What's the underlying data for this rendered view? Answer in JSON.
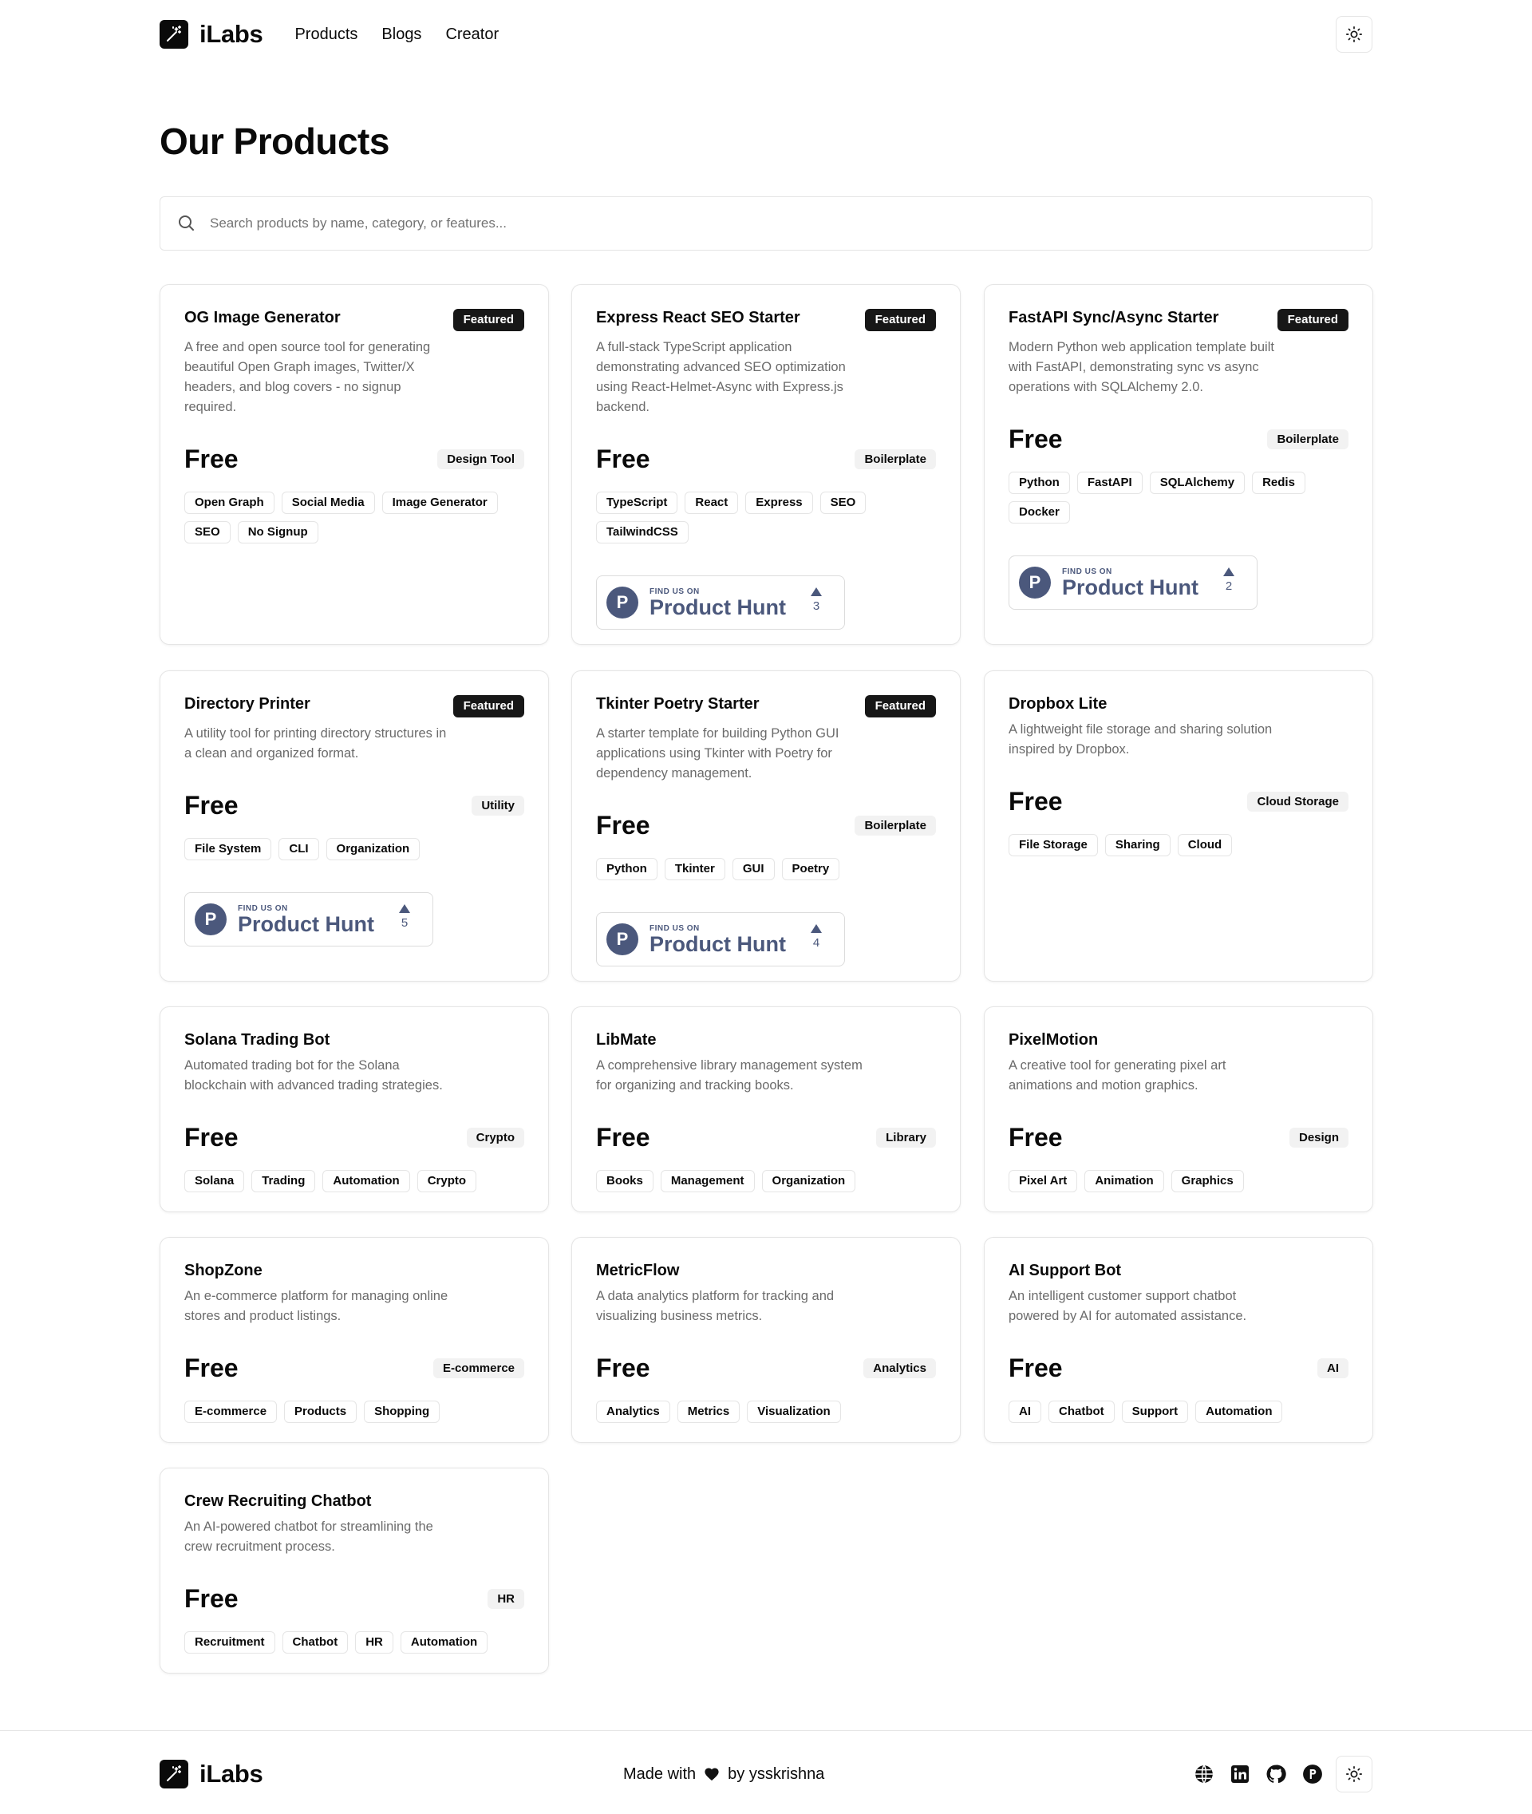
{
  "header": {
    "brand": "iLabs",
    "nav": [
      "Products",
      "Blogs",
      "Creator"
    ]
  },
  "page": {
    "title": "Our Products",
    "search_placeholder": "Search products by name, category, or features..."
  },
  "product_hunt": {
    "small": "FIND US ON",
    "big": "Product Hunt"
  },
  "products": [
    {
      "title": "OG Image Generator",
      "featured": "Featured",
      "desc": "A free and open source tool for generating beautiful Open Graph images, Twitter/X headers, and blog covers - no signup required.",
      "price": "Free",
      "category": "Design Tool",
      "tags": [
        "Open Graph",
        "Social Media",
        "Image Generator",
        "SEO",
        "No Signup"
      ]
    },
    {
      "title": "Express React SEO Starter",
      "featured": "Featured",
      "desc": "A full-stack TypeScript application demonstrating advanced SEO optimization using React-Helmet-Async with Express.js backend.",
      "price": "Free",
      "category": "Boilerplate",
      "tags": [
        "TypeScript",
        "React",
        "Express",
        "SEO",
        "TailwindCSS"
      ],
      "votes": "3"
    },
    {
      "title": "FastAPI Sync/Async Starter",
      "featured": "Featured",
      "desc": "Modern Python web application template built with FastAPI, demonstrating sync vs async operations with SQLAlchemy 2.0.",
      "price": "Free",
      "category": "Boilerplate",
      "tags": [
        "Python",
        "FastAPI",
        "SQLAlchemy",
        "Redis",
        "Docker"
      ],
      "votes": "2"
    },
    {
      "title": "Directory Printer",
      "featured": "Featured",
      "desc": "A utility tool for printing directory structures in a clean and organized format.",
      "price": "Free",
      "category": "Utility",
      "tags": [
        "File System",
        "CLI",
        "Organization"
      ],
      "votes": "5"
    },
    {
      "title": "Tkinter Poetry Starter",
      "featured": "Featured",
      "desc": "A starter template for building Python GUI applications using Tkinter with Poetry for dependency management.",
      "price": "Free",
      "category": "Boilerplate",
      "tags": [
        "Python",
        "Tkinter",
        "GUI",
        "Poetry"
      ],
      "votes": "4"
    },
    {
      "title": "Dropbox Lite",
      "desc": "A lightweight file storage and sharing solution inspired by Dropbox.",
      "price": "Free",
      "category": "Cloud Storage",
      "tags": [
        "File Storage",
        "Sharing",
        "Cloud"
      ]
    },
    {
      "title": "Solana Trading Bot",
      "desc": "Automated trading bot for the Solana blockchain with advanced trading strategies.",
      "price": "Free",
      "category": "Crypto",
      "tags": [
        "Solana",
        "Trading",
        "Automation",
        "Crypto"
      ]
    },
    {
      "title": "LibMate",
      "desc": "A comprehensive library management system for organizing and tracking books.",
      "price": "Free",
      "category": "Library",
      "tags": [
        "Books",
        "Management",
        "Organization"
      ]
    },
    {
      "title": "PixelMotion",
      "desc": "A creative tool for generating pixel art animations and motion graphics.",
      "price": "Free",
      "category": "Design",
      "tags": [
        "Pixel Art",
        "Animation",
        "Graphics"
      ]
    },
    {
      "title": "ShopZone",
      "desc": "An e-commerce platform for managing online stores and product listings.",
      "price": "Free",
      "category": "E-commerce",
      "tags": [
        "E-commerce",
        "Products",
        "Shopping"
      ]
    },
    {
      "title": "MetricFlow",
      "desc": "A data analytics platform for tracking and visualizing business metrics.",
      "price": "Free",
      "category": "Analytics",
      "tags": [
        "Analytics",
        "Metrics",
        "Visualization"
      ]
    },
    {
      "title": "AI Support Bot",
      "desc": "An intelligent customer support chatbot powered by AI for automated assistance.",
      "price": "Free",
      "category": "AI",
      "tags": [
        "AI",
        "Chatbot",
        "Support",
        "Automation"
      ]
    },
    {
      "title": "Crew Recruiting Chatbot",
      "desc": "An AI-powered chatbot for streamlining the crew recruitment process.",
      "price": "Free",
      "category": "HR",
      "tags": [
        "Recruitment",
        "Chatbot",
        "HR",
        "Automation"
      ]
    }
  ],
  "footer": {
    "brand": "iLabs",
    "made_with": "Made with",
    "by": "by ysskrishna"
  },
  "icons": [
    "wand-icon",
    "sun-icon",
    "search-icon",
    "globe-icon",
    "linkedin-icon",
    "github-icon",
    "producthunt-icon",
    "heart-icon"
  ]
}
